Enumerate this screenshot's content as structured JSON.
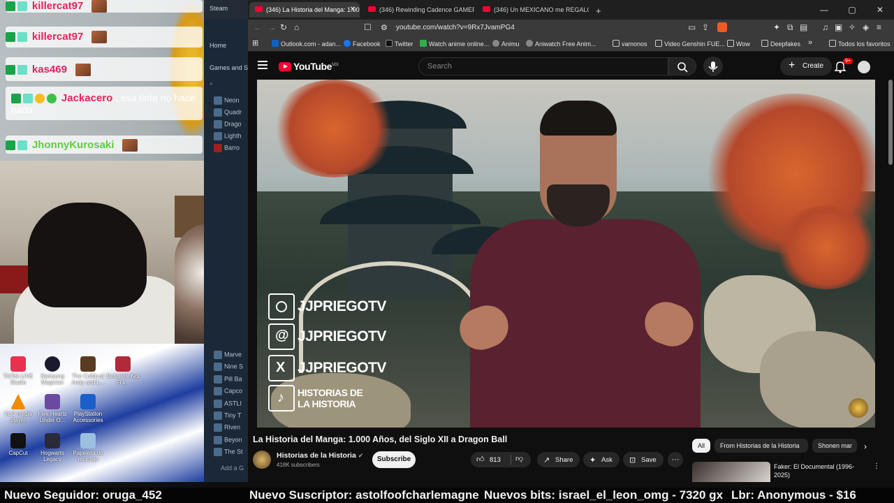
{
  "chat": {
    "messages": [
      {
        "user": "killercat97",
        "text": ":"
      },
      {
        "user": "killercat97",
        "text": ":"
      },
      {
        "user": "kas469",
        "text": ":"
      },
      {
        "user": "Jackacero",
        "text": ": esa tinta no hace nada"
      },
      {
        "user": "JhonnyKurosaki",
        "text": ":"
      }
    ]
  },
  "desktop": {
    "icons": [
      {
        "label": "TikTok LIVE Studio",
        "color": "#e8304f"
      },
      {
        "label": "Samsung Magician",
        "color": "#1a1a2e"
      },
      {
        "label": "The Coffin of Andy and L...",
        "color": "#5a3a22"
      },
      {
        "label": "Definitely Not Fra...",
        "color": "#b02a3a"
      },
      {
        "label": "VLC media player",
        "color": "#f08a00"
      },
      {
        "label": "Five Hearts Under O...",
        "color": "#6a4aa0"
      },
      {
        "label": "PlayStation Accessories",
        "color": "#1a60c8"
      },
      {
        "label": "CapCut",
        "color": "#111111"
      },
      {
        "label": "Hogwarts Legacy",
        "color": "#2a2a3a"
      },
      {
        "label": "Papelera de reciclaje",
        "color": "#9cc0e0"
      }
    ]
  },
  "steam": {
    "tab_label": "Steam",
    "nav_home": "Home",
    "nav_games": "Games and S",
    "games_top": [
      "Neon",
      "Quadr",
      "Drago",
      "Lighth",
      "Barro"
    ],
    "games_bottom": [
      "Marve",
      "Nine S",
      "Pill Ba",
      "Capco",
      "ASTLI",
      "Tiny T",
      "Riven",
      "Beyon",
      "The St"
    ],
    "add_game": "Add a G"
  },
  "browser": {
    "tabs": [
      {
        "label": "(346) La Historia del Manga: 1.00",
        "active": true
      },
      {
        "label": "(346) Rewinding Cadence GAMEPLAY",
        "active": false
      },
      {
        "label": "(346) Un MEXICANO me REGALÓ ES",
        "active": false
      }
    ],
    "new_tab": "+",
    "url": "youtube.com/watch?v=9Rx7JvamPG4",
    "bookmarks": [
      {
        "label": "Outlook.com - adan...",
        "color": "#0a64c8"
      },
      {
        "label": "Facebook",
        "color": "#1877f2"
      },
      {
        "label": "Twitter",
        "color": "#111111"
      },
      {
        "label": "Watch anime online...",
        "color": "#2fae4b"
      },
      {
        "label": "Animu",
        "color": "#888888"
      },
      {
        "label": "Aniwatch Free Anim...",
        "color": "#888888"
      },
      {
        "label": "vamonos",
        "color": "folder"
      },
      {
        "label": "Video Genshin FUE...",
        "color": "folder"
      },
      {
        "label": "Wow",
        "color": "folder"
      },
      {
        "label": "Deepfakes",
        "color": "folder"
      }
    ],
    "bookmarks_more": "»",
    "all_favorites": "Todos los favoritos"
  },
  "youtube": {
    "logo_text": "YouTube",
    "region": "MX",
    "search_placeholder": "Search",
    "create_label": "Create",
    "notifications": "9+",
    "video": {
      "title": "La Historia del Manga: 1.000 Años, del Siglo XII a Dragon Ball",
      "channel": "Historias de la Historia",
      "subscribers": "418K subscribers",
      "subscribe": "Subscribe",
      "likes": "813",
      "share": "Share",
      "ask": "Ask",
      "save": "Save",
      "more": "···",
      "overlay_handles": [
        "JJPRIEGOTV",
        "JJPRIEGOTV",
        "JJPRIEGOTV"
      ],
      "overlay_tiktok_line1": "HISTORIAS DE",
      "overlay_tiktok_line2": "LA HISTORIA"
    },
    "chips": [
      {
        "label": "All",
        "active": true
      },
      {
        "label": "From Historias de la Historia",
        "active": false
      },
      {
        "label": "Shonen mar",
        "active": false
      }
    ],
    "recommended": {
      "title": "Faker: El Documental (1996-2025)"
    }
  },
  "ticker": {
    "follower": "Nuevo Seguidor: oruga_452",
    "subscriber": "Nuevo Suscriptor: astolfoofcharlemagne",
    "bits": "Nuevos bits: israel_el_leon_omg - 7320 gx",
    "donation": "Lbr: Anonymous - $16"
  },
  "colors": {
    "youtube_red": "#ff0033",
    "chat_name_pink": "#e0245e",
    "chat_name_green": "#5ccf3c",
    "browser_bg": "#0f0f0f"
  }
}
